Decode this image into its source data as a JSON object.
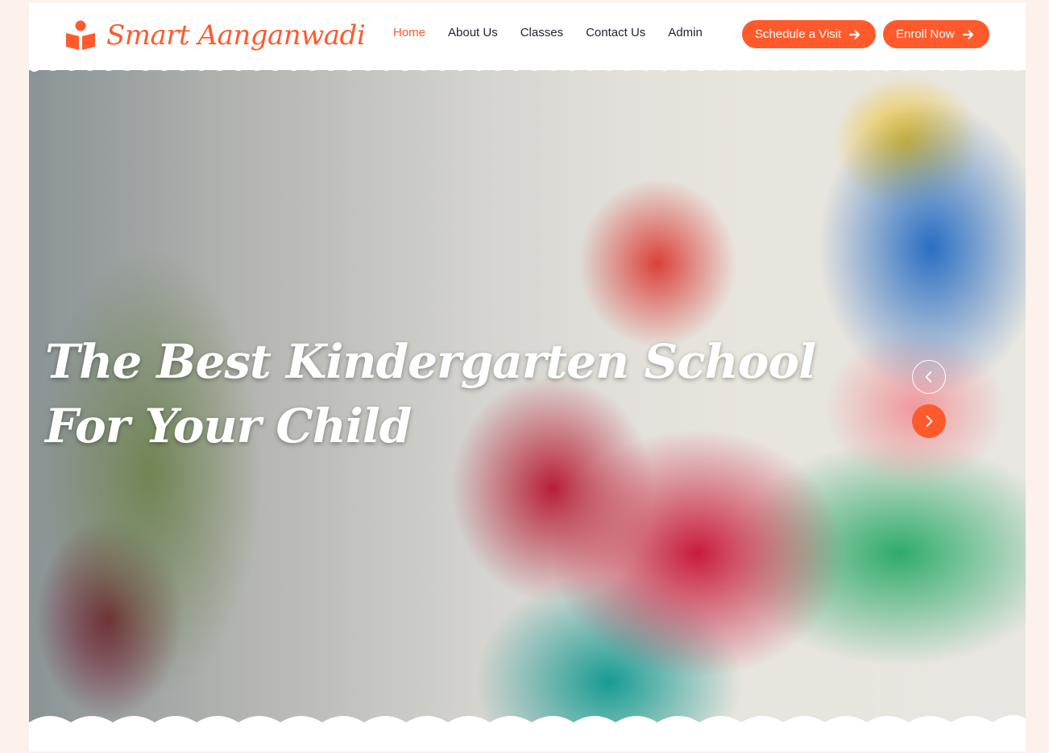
{
  "brand": {
    "name": "Smart Aanganwadi",
    "icon": "book-reader-icon",
    "color": "#ff5a2c"
  },
  "nav": {
    "items": [
      {
        "label": "Home",
        "active": true
      },
      {
        "label": "About Us",
        "active": false
      },
      {
        "label": "Classes",
        "active": false
      },
      {
        "label": "Contact Us",
        "active": false
      },
      {
        "label": "Admin",
        "active": false
      }
    ]
  },
  "actions": {
    "schedule_label": "Schedule a Visit",
    "enroll_label": "Enroll Now",
    "arrow_icon": "arrow-right-icon"
  },
  "hero": {
    "title_line1": "The Best Kindergarten School",
    "title_line2": "For Your Child",
    "image": "children-on-swing-photo",
    "prev_icon": "chevron-left-icon",
    "next_icon": "chevron-right-icon"
  }
}
